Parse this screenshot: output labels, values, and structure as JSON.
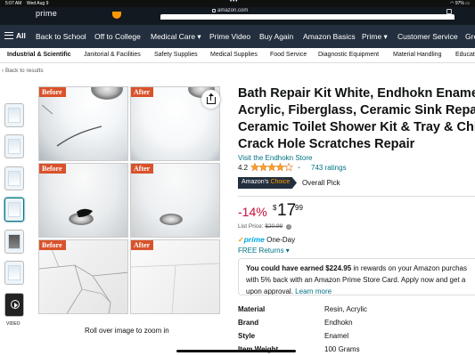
{
  "status_bar": {
    "time": "5:07 AM",
    "date": "Wed Aug 9",
    "battery": "97%"
  },
  "browser": {
    "url": "amazon.com",
    "logo_fragment": "prime"
  },
  "nav": {
    "all_label": "All",
    "items": [
      "Back to School",
      "Off to College",
      "Medical Care ▾",
      "Prime Video",
      "Buy Again",
      "Amazon Basics",
      "Prime ▾",
      "Customer Service",
      "Gre"
    ]
  },
  "categories": {
    "items": [
      "Industrial & Scientific",
      "Janitorial & Facilities",
      "Safety Supplies",
      "Medical Supplies",
      "Food Service",
      "Diagnostic Equipment",
      "Material Handling",
      "Educat"
    ]
  },
  "back_link": "‹ Back to results",
  "gallery": {
    "video_label": "VIDEO",
    "tags": {
      "before": "Before",
      "after": "After"
    },
    "zoom_hint": "Roll over image to zoom in"
  },
  "product": {
    "title_lines": [
      "Bath Repair Kit White, Endhokn Enamel, P",
      "Acrylic, Fiberglass, Ceramic Sink Repair Kit",
      "Ceramic Toilet Shower Kit & Tray & Chip &",
      "Crack Hole Scratches Repair"
    ],
    "store_link": "Visit the Endhokn Store",
    "rating_value": "4.2",
    "rating_stars": 4.2,
    "rating_count": "743 ratings",
    "badge_prefix": "Amazon's",
    "badge_accent": "Choice",
    "overall_pick": "Overall Pick",
    "discount": "-14%",
    "price_symbol": "$",
    "price_whole": "17",
    "price_fraction": "99",
    "list_price_label": "List Price:",
    "list_price_value": "$20.99",
    "prime_check": "✓",
    "prime_word": "prime",
    "prime_delivery": "One-Day",
    "free_returns": "FREE Returns ▾",
    "promo": {
      "prefix": "You could have earned",
      "amount": "$224.95",
      "line1_rest": "in rewards on your Amazon purchas",
      "line2": "with 5% back with an Amazon Prime Store Card. Apply now and get a",
      "line3_pre": "upon approval.",
      "learn_more": "Learn more"
    },
    "specs": [
      {
        "key": "Material",
        "value": "Resin, Acrylic"
      },
      {
        "key": "Brand",
        "value": "Endhokn"
      },
      {
        "key": "Style",
        "value": "Enamel"
      },
      {
        "key": "Item Weight",
        "value": "100 Grams"
      }
    ]
  },
  "colors": {
    "nav_bg": "#232f3e",
    "link": "#007185",
    "discount": "#cc0c39",
    "star": "#ffa41c",
    "prime_blue": "#00a8e1",
    "tag_orange": "#d9522b"
  }
}
